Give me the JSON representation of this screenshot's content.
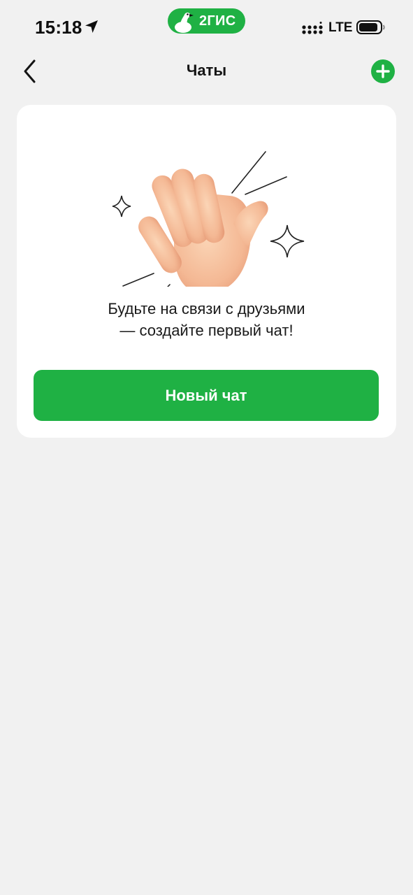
{
  "status_bar": {
    "time": "15:18",
    "app_badge": "2ГИС",
    "network": "LTE"
  },
  "nav": {
    "title": "Чаты"
  },
  "empty_state": {
    "line1": "Будьте на связи с друзьями",
    "line2": "— создайте первый чат!",
    "button_label": "Новый чат"
  },
  "colors": {
    "accent": "#1fb144",
    "background": "#f1f1f1",
    "card": "#ffffff"
  },
  "icons": {
    "back": "chevron-left-icon",
    "add": "plus-circle-icon",
    "location": "location-arrow-icon",
    "signal": "signal-icon",
    "battery": "battery-icon",
    "illustration": "waving-hand-icon"
  }
}
